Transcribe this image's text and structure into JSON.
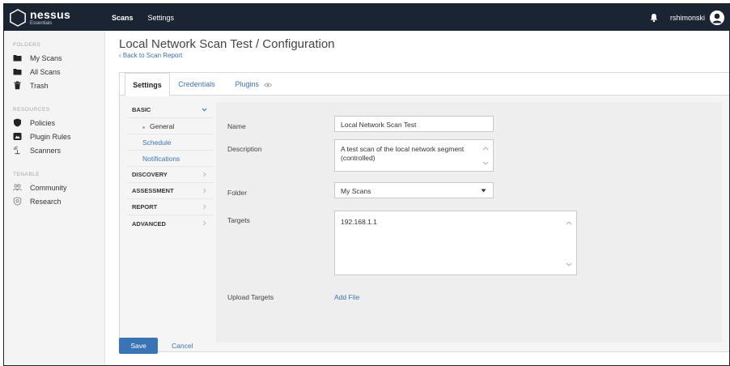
{
  "app": {
    "brand_name": "nessus",
    "brand_sub": "Essentials"
  },
  "topnav": {
    "scans": "Scans",
    "settings": "Settings",
    "username": "rshimonski"
  },
  "sidebar": {
    "folders_title": "FOLDERS",
    "folders": [
      "My Scans",
      "All Scans",
      "Trash"
    ],
    "resources_title": "RESOURCES",
    "resources": [
      "Policies",
      "Plugin Rules",
      "Scanners"
    ],
    "tenable_title": "TENABLE",
    "tenable": [
      "Community",
      "Research"
    ]
  },
  "page": {
    "title": "Local Network Scan Test / Configuration",
    "back_link": "‹ Back to Scan Report"
  },
  "tabs": [
    "Settings",
    "Credentials",
    "Plugins"
  ],
  "subnav": {
    "basic": "BASIC",
    "basic_items": [
      "General",
      "Schedule",
      "Notifications"
    ],
    "discovery": "DISCOVERY",
    "assessment": "ASSESSMENT",
    "report": "REPORT",
    "advanced": "ADVANCED"
  },
  "form": {
    "name_label": "Name",
    "name_value": "Local Network Scan Test",
    "description_label": "Description",
    "description_value": "A test scan of the local network segment (controlled)",
    "folder_label": "Folder",
    "folder_value": "My Scans",
    "targets_label": "Targets",
    "targets_value": "192.168.1.1",
    "upload_label": "Upload Targets",
    "add_file": "Add File"
  },
  "actions": {
    "save": "Save",
    "cancel": "Cancel"
  },
  "colors": {
    "topbar": "#1b2433",
    "link": "#3b74b5",
    "save_button": "#3b74b5"
  }
}
